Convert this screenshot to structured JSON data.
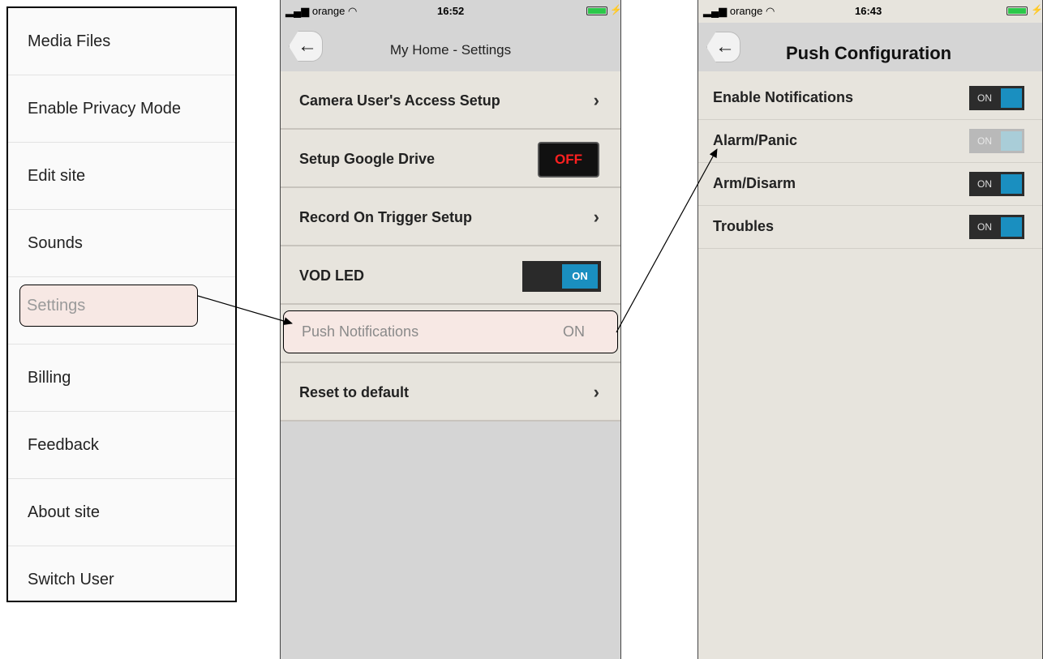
{
  "menu": {
    "items": [
      {
        "label": "Media Files"
      },
      {
        "label": "Enable Privacy Mode"
      },
      {
        "label": "Edit site"
      },
      {
        "label": "Sounds"
      },
      {
        "label": "Settings"
      },
      {
        "label": "Billing"
      },
      {
        "label": "Feedback"
      },
      {
        "label": "About site"
      },
      {
        "label": "Switch User"
      }
    ]
  },
  "settings_screen": {
    "status": {
      "carrier": "orange",
      "time": "16:52"
    },
    "back_glyph": "←",
    "title": "My Home - Settings",
    "rows": [
      {
        "label": "Camera User's Access Setup",
        "chevron": "›"
      },
      {
        "label": "Setup Google Drive",
        "toggle": "OFF"
      },
      {
        "label": "Record On Trigger Setup",
        "chevron": "›"
      },
      {
        "label": "VOD LED",
        "toggle": "ON"
      },
      {
        "label": "Push Notifications",
        "value": "ON"
      },
      {
        "label": "Reset to default",
        "chevron": "›"
      }
    ]
  },
  "push_screen": {
    "status": {
      "carrier": "orange",
      "time": "16:43"
    },
    "back_glyph": "←",
    "title": "Push Configuration",
    "rows": [
      {
        "label": "Enable Notifications",
        "toggle": "ON",
        "enabled": true
      },
      {
        "label": "Alarm/Panic",
        "toggle": "ON",
        "enabled": false
      },
      {
        "label": "Arm/Disarm",
        "toggle": "ON",
        "enabled": true
      },
      {
        "label": "Troubles",
        "toggle": "ON",
        "enabled": true
      }
    ]
  },
  "colors": {
    "toggle_on": "#1a8fc0",
    "off_text": "#ff2020",
    "highlight": "#f7e8e4",
    "battery": "#2bc84a"
  }
}
